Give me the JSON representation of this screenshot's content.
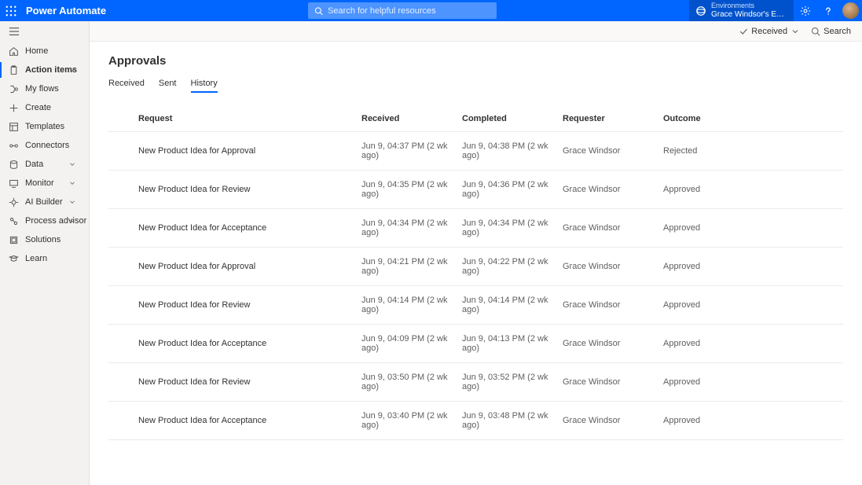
{
  "header": {
    "app_title": "Power Automate",
    "search_placeholder": "Search for helpful resources",
    "env_label": "Environments",
    "env_name": "Grace Windsor's Enviro..."
  },
  "sidebar": {
    "items": [
      {
        "label": "Home",
        "icon": "home",
        "expandable": false
      },
      {
        "label": "Action items",
        "icon": "clipboard",
        "expandable": true,
        "active": true
      },
      {
        "label": "My flows",
        "icon": "flow",
        "expandable": false
      },
      {
        "label": "Create",
        "icon": "plus",
        "expandable": false
      },
      {
        "label": "Templates",
        "icon": "template",
        "expandable": false
      },
      {
        "label": "Connectors",
        "icon": "connector",
        "expandable": false
      },
      {
        "label": "Data",
        "icon": "data",
        "expandable": true
      },
      {
        "label": "Monitor",
        "icon": "monitor",
        "expandable": true
      },
      {
        "label": "AI Builder",
        "icon": "ai",
        "expandable": true
      },
      {
        "label": "Process advisor",
        "icon": "process",
        "expandable": true
      },
      {
        "label": "Solutions",
        "icon": "solutions",
        "expandable": false
      },
      {
        "label": "Learn",
        "icon": "learn",
        "expandable": false
      }
    ]
  },
  "cmdbar": {
    "filter_label": "Received",
    "search_label": "Search"
  },
  "page": {
    "title": "Approvals",
    "tabs": [
      "Received",
      "Sent",
      "History"
    ],
    "active_tab": "History"
  },
  "table": {
    "headers": {
      "request": "Request",
      "received": "Received",
      "completed": "Completed",
      "requester": "Requester",
      "outcome": "Outcome"
    },
    "rows": [
      {
        "request": "New Product Idea for Approval",
        "received": "Jun 9, 04:37 PM (2 wk ago)",
        "completed": "Jun 9, 04:38 PM (2 wk ago)",
        "requester": "Grace Windsor",
        "outcome": "Rejected"
      },
      {
        "request": "New Product Idea for Review",
        "received": "Jun 9, 04:35 PM (2 wk ago)",
        "completed": "Jun 9, 04:36 PM (2 wk ago)",
        "requester": "Grace Windsor",
        "outcome": "Approved"
      },
      {
        "request": "New Product Idea for Acceptance",
        "received": "Jun 9, 04:34 PM (2 wk ago)",
        "completed": "Jun 9, 04:34 PM (2 wk ago)",
        "requester": "Grace Windsor",
        "outcome": "Approved"
      },
      {
        "request": "New Product Idea for Approval",
        "received": "Jun 9, 04:21 PM (2 wk ago)",
        "completed": "Jun 9, 04:22 PM (2 wk ago)",
        "requester": "Grace Windsor",
        "outcome": "Approved"
      },
      {
        "request": "New Product Idea for Review",
        "received": "Jun 9, 04:14 PM (2 wk ago)",
        "completed": "Jun 9, 04:14 PM (2 wk ago)",
        "requester": "Grace Windsor",
        "outcome": "Approved"
      },
      {
        "request": "New Product Idea for Acceptance",
        "received": "Jun 9, 04:09 PM (2 wk ago)",
        "completed": "Jun 9, 04:13 PM (2 wk ago)",
        "requester": "Grace Windsor",
        "outcome": "Approved"
      },
      {
        "request": "New Product Idea for Review",
        "received": "Jun 9, 03:50 PM (2 wk ago)",
        "completed": "Jun 9, 03:52 PM (2 wk ago)",
        "requester": "Grace Windsor",
        "outcome": "Approved"
      },
      {
        "request": "New Product Idea for Acceptance",
        "received": "Jun 9, 03:40 PM (2 wk ago)",
        "completed": "Jun 9, 03:48 PM (2 wk ago)",
        "requester": "Grace Windsor",
        "outcome": "Approved"
      }
    ]
  }
}
